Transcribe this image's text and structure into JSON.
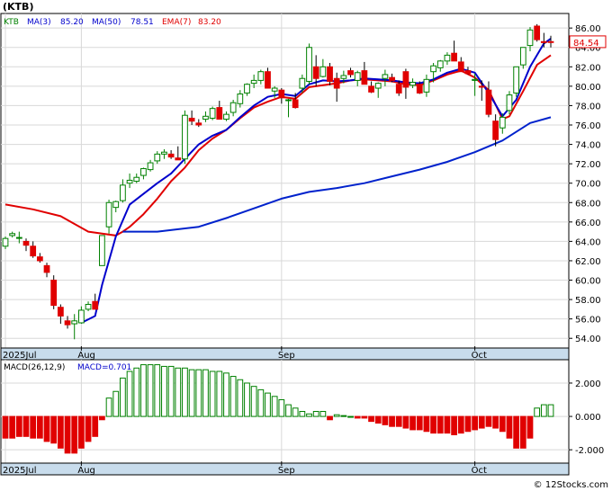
{
  "chart_data": [
    {
      "type": "candlestick",
      "ticker_label": "(KTB)",
      "legend": {
        "symbol": "KTB",
        "ma3_label": "MA(3)",
        "ma3_value": "85.20",
        "ma50_label": "MA(50)",
        "ma50_value": "78.51",
        "ema7_label": "EMA(7)",
        "ema7_value": "83.20"
      },
      "colors": {
        "up": "#008000",
        "down": "#e00000",
        "ma_fast": "#0000cc",
        "ma_slow": "#0022cc",
        "ema": "#e00000",
        "price_tag": "#e00000"
      },
      "last_price_tag": "84.54",
      "ylim": [
        53,
        87.5
      ],
      "y_ticks": [
        "54.00",
        "56.00",
        "58.00",
        "60.00",
        "62.00",
        "64.00",
        "66.00",
        "68.00",
        "70.00",
        "72.00",
        "74.00",
        "76.00",
        "78.00",
        "80.00",
        "82.00",
        "84.00",
        "86.00"
      ],
      "x_labels": [
        "2025Jul",
        "Aug",
        "Sep",
        "Oct"
      ],
      "x_label_index": [
        0,
        11,
        40,
        68
      ],
      "ohlc": [
        [
          63.5,
          64.5,
          63.2,
          64.3
        ],
        [
          64.6,
          65.0,
          64.4,
          64.8
        ],
        [
          64.4,
          65.0,
          63.8,
          64.4
        ],
        [
          64.0,
          64.3,
          63.0,
          63.6
        ],
        [
          63.5,
          64.0,
          62.3,
          62.5
        ],
        [
          62.4,
          62.8,
          61.8,
          62.0
        ],
        [
          61.5,
          61.8,
          60.3,
          60.8
        ],
        [
          60.0,
          60.5,
          57.0,
          57.4
        ],
        [
          57.2,
          57.5,
          55.5,
          56.3
        ],
        [
          55.8,
          56.3,
          55.0,
          55.4
        ],
        [
          55.5,
          56.5,
          53.9,
          55.8
        ],
        [
          55.6,
          57.3,
          55.5,
          56.9
        ],
        [
          57.0,
          57.8,
          56.8,
          57.5
        ],
        [
          57.8,
          58.6,
          57.3,
          57.0
        ],
        [
          61.5,
          64.5,
          61.5,
          64.6
        ],
        [
          65.5,
          68.3,
          64.8,
          68.0
        ],
        [
          67.5,
          68.2,
          67.0,
          68.1
        ],
        [
          68.2,
          70.4,
          68.0,
          69.8
        ],
        [
          70.0,
          71.0,
          69.5,
          70.3
        ],
        [
          70.2,
          71.0,
          70.0,
          70.6
        ],
        [
          70.8,
          71.6,
          70.4,
          71.5
        ],
        [
          71.4,
          72.4,
          71.2,
          72.1
        ],
        [
          72.3,
          73.3,
          72.0,
          73.0
        ],
        [
          73.0,
          73.5,
          72.5,
          73.2
        ],
        [
          73.0,
          73.4,
          72.5,
          72.7
        ],
        [
          72.6,
          73.8,
          72.5,
          72.4
        ],
        [
          72.5,
          77.5,
          72.0,
          77.0
        ],
        [
          76.7,
          77.5,
          76.0,
          76.4
        ],
        [
          76.2,
          76.6,
          75.8,
          76.0
        ],
        [
          76.6,
          77.4,
          76.3,
          76.9
        ],
        [
          76.7,
          77.9,
          76.5,
          77.7
        ],
        [
          77.8,
          78.5,
          77.0,
          76.6
        ],
        [
          76.6,
          77.4,
          76.4,
          77.1
        ],
        [
          77.3,
          78.6,
          76.9,
          78.3
        ],
        [
          78.2,
          79.6,
          77.8,
          79.2
        ],
        [
          79.3,
          80.3,
          79.0,
          80.2
        ],
        [
          80.3,
          81.2,
          79.8,
          80.6
        ],
        [
          80.6,
          81.7,
          80.2,
          81.5
        ],
        [
          81.5,
          81.9,
          80.8,
          79.8
        ],
        [
          79.5,
          80.0,
          78.8,
          79.8
        ],
        [
          79.6,
          79.8,
          78.2,
          78.8
        ],
        [
          78.6,
          78.7,
          76.8,
          78.6
        ],
        [
          78.6,
          79.3,
          77.7,
          77.8
        ],
        [
          79.8,
          81.2,
          79.3,
          80.8
        ],
        [
          80.5,
          84.4,
          80.2,
          84.0
        ],
        [
          82.0,
          83.2,
          80.0,
          80.8
        ],
        [
          81.0,
          82.8,
          80.9,
          82.0
        ],
        [
          82.0,
          82.4,
          80.1,
          80.5
        ],
        [
          80.8,
          81.4,
          78.4,
          79.8
        ],
        [
          80.8,
          81.6,
          80.3,
          81.1
        ],
        [
          81.6,
          81.9,
          80.9,
          81.2
        ],
        [
          80.6,
          81.6,
          80.0,
          81.4
        ],
        [
          81.6,
          82.5,
          80.8,
          80.2
        ],
        [
          80.0,
          80.5,
          79.3,
          79.4
        ],
        [
          79.8,
          80.4,
          78.8,
          80.3
        ],
        [
          80.8,
          81.7,
          80.0,
          81.2
        ],
        [
          80.9,
          81.3,
          80.4,
          80.6
        ],
        [
          80.2,
          80.6,
          79.0,
          79.3
        ],
        [
          81.5,
          81.8,
          78.7,
          79.9
        ],
        [
          80.1,
          80.8,
          79.8,
          80.4
        ],
        [
          80.2,
          80.5,
          79.2,
          79.3
        ],
        [
          79.4,
          81.2,
          78.9,
          80.7
        ],
        [
          81.5,
          82.4,
          80.4,
          82.1
        ],
        [
          81.9,
          82.7,
          81.5,
          82.6
        ],
        [
          82.6,
          83.5,
          82.2,
          83.2
        ],
        [
          83.4,
          84.7,
          82.8,
          82.6
        ],
        [
          82.5,
          83.0,
          81.8,
          81.5
        ],
        [
          81.6,
          82.0,
          81.2,
          81.3
        ],
        [
          80.6,
          81.3,
          79.0,
          80.7
        ],
        [
          80.0,
          80.6,
          78.5,
          79.9
        ],
        [
          79.6,
          80.5,
          76.8,
          77.1
        ],
        [
          76.4,
          77.1,
          73.8,
          74.5
        ],
        [
          75.7,
          77.2,
          75.1,
          76.8
        ],
        [
          77.5,
          79.5,
          77.1,
          79.1
        ],
        [
          79.3,
          81.5,
          78.9,
          82.0
        ],
        [
          82.2,
          84.0,
          81.8,
          84.0
        ],
        [
          84.2,
          86.1,
          83.6,
          85.8
        ],
        [
          86.2,
          86.4,
          84.6,
          84.8
        ],
        [
          84.6,
          85.5,
          84.0,
          84.5
        ],
        [
          84.6,
          85.2,
          84.0,
          84.54
        ]
      ],
      "ma_fast": [
        [
          0,
          null
        ],
        [
          11,
          55.6
        ],
        [
          13,
          56.3
        ],
        [
          14,
          59.5
        ],
        [
          16,
          64.5
        ],
        [
          18,
          67.8
        ],
        [
          20,
          68.9
        ],
        [
          22,
          70.0
        ],
        [
          24,
          71.0
        ],
        [
          26,
          72.5
        ],
        [
          28,
          74.0
        ],
        [
          30,
          74.9
        ],
        [
          32,
          75.5
        ],
        [
          34,
          76.8
        ],
        [
          36,
          78.0
        ],
        [
          38,
          78.9
        ],
        [
          40,
          79.2
        ],
        [
          42,
          79.0
        ],
        [
          44,
          80.2
        ],
        [
          46,
          80.6
        ],
        [
          48,
          80.5
        ],
        [
          50,
          80.6
        ],
        [
          52,
          80.8
        ],
        [
          54,
          80.7
        ],
        [
          56,
          80.6
        ],
        [
          58,
          80.4
        ],
        [
          60,
          80.3
        ],
        [
          62,
          80.7
        ],
        [
          64,
          81.4
        ],
        [
          66,
          81.8
        ],
        [
          68,
          81.4
        ],
        [
          70,
          79.3
        ],
        [
          72,
          76.9
        ],
        [
          74,
          78.6
        ],
        [
          76,
          82.0
        ],
        [
          78,
          84.4
        ],
        [
          79,
          84.9
        ]
      ],
      "ma_slow": [
        [
          0,
          null
        ],
        [
          17,
          65.0
        ],
        [
          22,
          65.0
        ],
        [
          28,
          65.5
        ],
        [
          32,
          66.4
        ],
        [
          36,
          67.4
        ],
        [
          40,
          68.4
        ],
        [
          44,
          69.1
        ],
        [
          48,
          69.5
        ],
        [
          52,
          70.0
        ],
        [
          56,
          70.7
        ],
        [
          60,
          71.4
        ],
        [
          64,
          72.2
        ],
        [
          68,
          73.2
        ],
        [
          72,
          74.4
        ],
        [
          76,
          76.2
        ],
        [
          79,
          76.8
        ]
      ],
      "ema": [
        [
          0,
          67.8
        ],
        [
          4,
          67.3
        ],
        [
          8,
          66.6
        ],
        [
          10,
          65.8
        ],
        [
          12,
          65.0
        ],
        [
          14,
          64.8
        ],
        [
          16,
          64.6
        ],
        [
          17,
          65.0
        ],
        [
          18,
          65.5
        ],
        [
          20,
          66.8
        ],
        [
          22,
          68.4
        ],
        [
          24,
          70.2
        ],
        [
          26,
          71.6
        ],
        [
          28,
          73.4
        ],
        [
          30,
          74.6
        ],
        [
          32,
          75.5
        ],
        [
          34,
          76.7
        ],
        [
          36,
          77.8
        ],
        [
          38,
          78.4
        ],
        [
          40,
          78.9
        ],
        [
          42,
          78.7
        ],
        [
          44,
          79.9
        ],
        [
          46,
          80.1
        ],
        [
          48,
          80.3
        ],
        [
          50,
          80.6
        ],
        [
          52,
          80.7
        ],
        [
          54,
          80.6
        ],
        [
          56,
          80.5
        ],
        [
          58,
          80.2
        ],
        [
          60,
          80.1
        ],
        [
          62,
          80.6
        ],
        [
          64,
          81.2
        ],
        [
          66,
          81.6
        ],
        [
          68,
          80.9
        ],
        [
          70,
          79.6
        ],
        [
          72,
          76.6
        ],
        [
          73,
          76.9
        ],
        [
          75,
          79.5
        ],
        [
          77,
          82.2
        ],
        [
          79,
          83.2
        ]
      ]
    },
    {
      "type": "bar",
      "title": "MACD(26,12,9)",
      "legend": {
        "label": "MACD(26,12,9)",
        "value_label": "MACD=0.701"
      },
      "ylim": [
        -2.8,
        3.4
      ],
      "y_ticks": [
        "2.000",
        "0.000",
        "-2.000"
      ],
      "x_labels": [
        "2025Jul",
        "Aug",
        "Sep",
        "Oct"
      ],
      "values": [
        -1.3,
        -1.3,
        -1.2,
        -1.2,
        -1.3,
        -1.3,
        -1.5,
        -1.6,
        -1.9,
        -2.2,
        -2.2,
        -1.9,
        -1.5,
        -1.2,
        -0.2,
        1.1,
        1.5,
        2.3,
        2.7,
        2.9,
        3.1,
        3.1,
        3.1,
        3.0,
        3.0,
        2.9,
        2.9,
        2.8,
        2.8,
        2.8,
        2.7,
        2.7,
        2.6,
        2.4,
        2.2,
        2.0,
        1.8,
        1.6,
        1.4,
        1.2,
        1.0,
        0.7,
        0.5,
        0.3,
        0.15,
        0.3,
        0.3,
        -0.2,
        0.1,
        0.05,
        0.0,
        -0.1,
        -0.1,
        -0.3,
        -0.4,
        -0.5,
        -0.6,
        -0.6,
        -0.7,
        -0.8,
        -0.8,
        -0.9,
        -1.0,
        -1.0,
        -1.0,
        -1.1,
        -1.0,
        -0.9,
        -0.8,
        -0.7,
        -0.6,
        -0.7,
        -0.9,
        -1.3,
        -1.9,
        -1.9,
        -1.3,
        0.5,
        0.7,
        0.7
      ]
    }
  ],
  "watermark": "© 12Stocks.com"
}
